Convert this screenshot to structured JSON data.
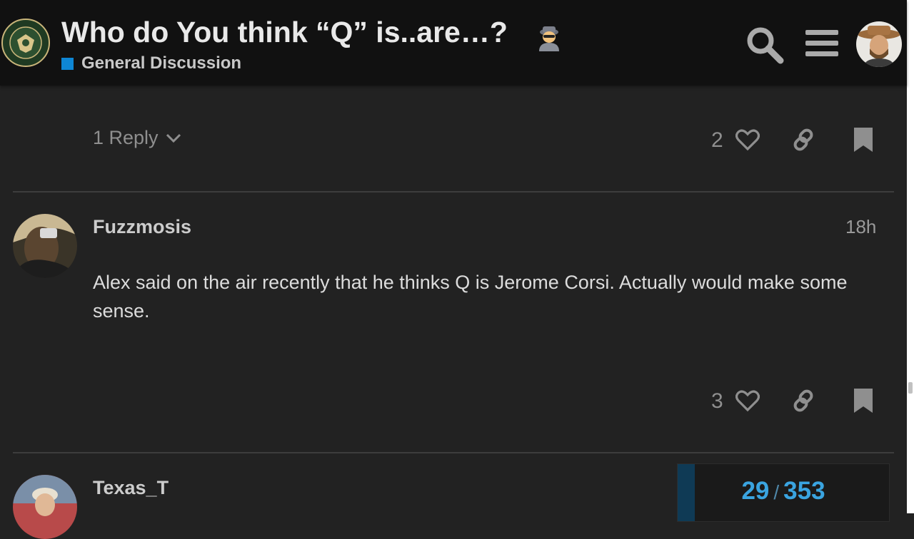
{
  "header": {
    "logo_text": "INFOWARS ARMY",
    "title": "Who do You think “Q” is..are…?",
    "title_emoji": "detective-icon",
    "category": "General Discussion",
    "category_color": "#0e86d4",
    "icons": [
      "search-icon",
      "menu-icon",
      "avatar"
    ]
  },
  "posts": [
    {
      "reply_label": "1 Reply",
      "likes": "2"
    },
    {
      "username": "Fuzzmosis",
      "date": "18h",
      "body": "Alex said on the air recently that he thinks Q is Jerome Corsi. Actually would make some sense.",
      "likes": "3"
    },
    {
      "username": "Texas_T"
    }
  ],
  "timeline": {
    "current": "29",
    "separator": "/",
    "total": "353",
    "progress_fraction": 0.08,
    "accent_color": "#3aa4e0"
  },
  "scrollbar": {
    "position_fraction": 0.75
  }
}
